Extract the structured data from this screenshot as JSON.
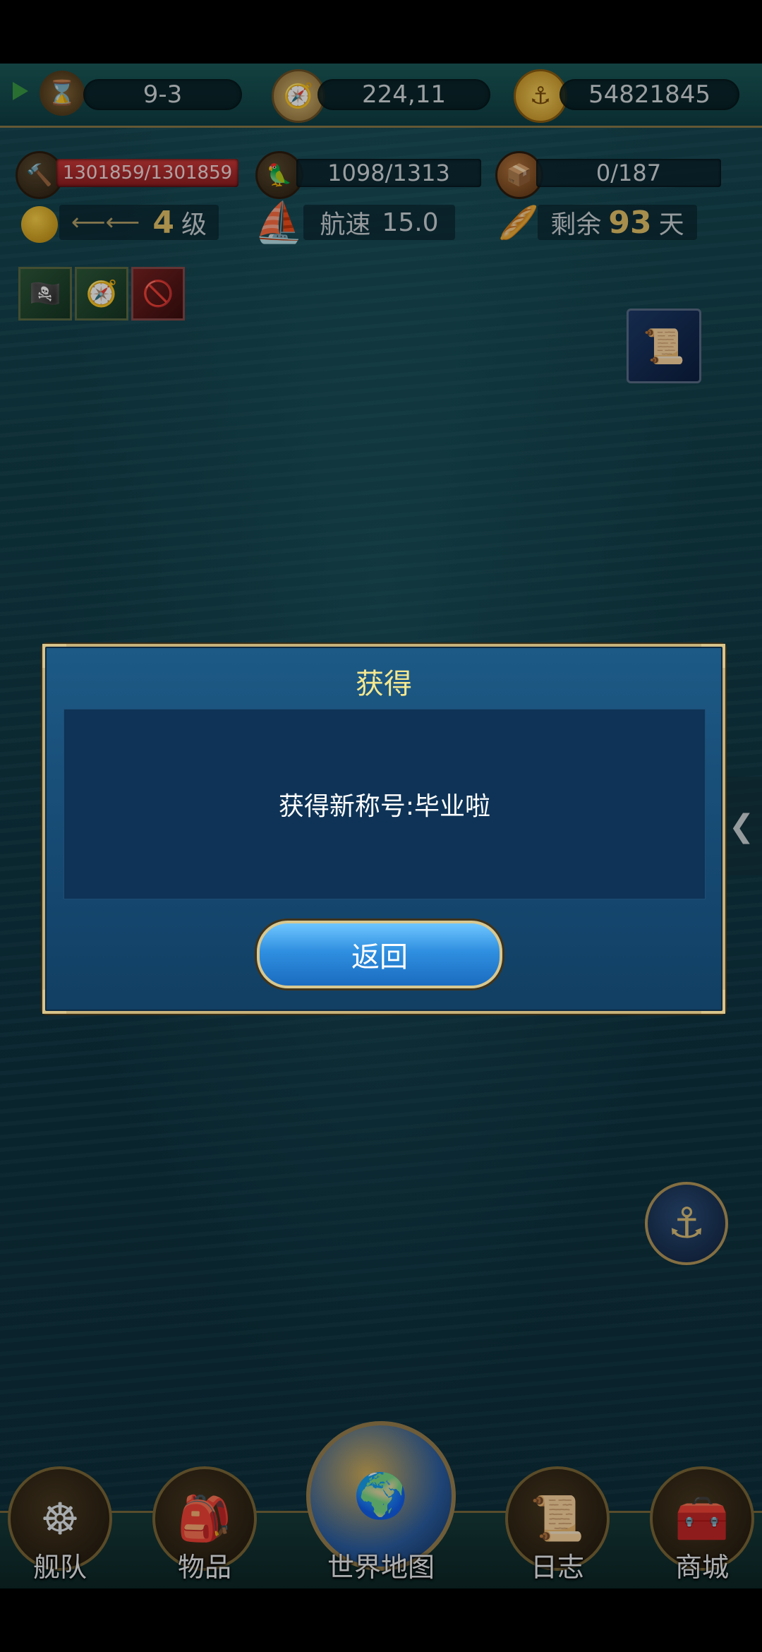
{
  "topbar": {
    "stage": "9-3",
    "coordinates": "224,11",
    "gold": "54821845"
  },
  "stats": {
    "hull": "1301859/1301859",
    "crew": "1098/1313",
    "cargo": "0/187"
  },
  "info": {
    "level_value": "4",
    "level_suffix": "级",
    "speed_label": "航速",
    "speed_value": "15.0",
    "remaining_label": "剩余",
    "remaining_value": "93",
    "remaining_unit": "天"
  },
  "dialog": {
    "title": "获得",
    "message": "获得新称号:毕业啦",
    "back_button": "返回"
  },
  "nav": {
    "fleet": "舰队",
    "items": "物品",
    "world_map": "世界地图",
    "log": "日志",
    "shop": "商城"
  },
  "icons": {
    "play": "play-icon",
    "hourglass": "hourglass-icon",
    "compass": "compass-icon",
    "gold_coin": "gold-coin-icon",
    "hammer": "hammer-icon",
    "crew": "crew-icon",
    "cargo": "cargo-box-icon",
    "level": "level-orb-icon",
    "ship": "ship-icon",
    "bread": "bread-icon",
    "pirate_flag": "pirate-flag-icon",
    "compass_buff": "compass-buff-icon",
    "no_crew": "no-crew-icon",
    "scroll": "scroll-icon",
    "anchor": "anchor-icon",
    "chevron_left": "chevron-left-icon"
  },
  "colors": {
    "dialog_title": "#f5e88f",
    "highlight_number": "#e8c56a",
    "hull_bar": "#b3262a"
  }
}
